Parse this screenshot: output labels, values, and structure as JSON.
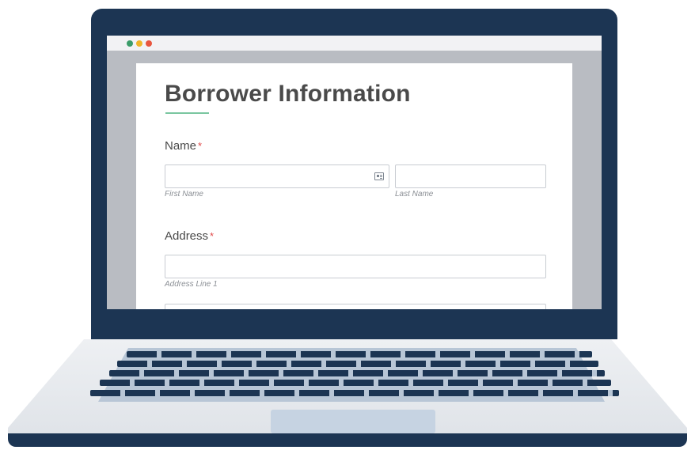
{
  "window": {
    "controls": [
      "green-dot",
      "yellow-dot",
      "red-dot"
    ]
  },
  "form": {
    "title": "Borrower Information",
    "name": {
      "label": "Name",
      "required_marker": "*",
      "first_name_sublabel": "First Name",
      "last_name_sublabel": "Last Name",
      "first_name_value": "",
      "last_name_value": ""
    },
    "address": {
      "label": "Address",
      "required_marker": "*",
      "line1_sublabel": "Address Line 1",
      "line1_value": ""
    }
  },
  "icons": {
    "first_name_field": "contact-card-icon"
  },
  "colors": {
    "laptop_frame": "#1c3553",
    "accent_rule": "#7ac6a0",
    "required": "#e14b4b",
    "keyboard_bg": "#b8c6d6"
  }
}
